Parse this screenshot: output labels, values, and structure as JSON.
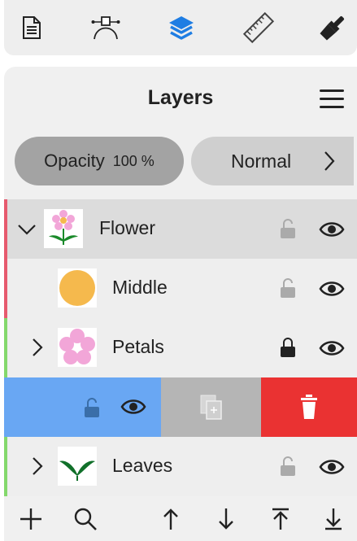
{
  "toolbar": {
    "tools": [
      {
        "icon": "document-icon",
        "active": false
      },
      {
        "icon": "vector-pen-icon",
        "active": false
      },
      {
        "icon": "layers-icon",
        "active": true
      },
      {
        "icon": "ruler-icon",
        "active": false
      },
      {
        "icon": "paint-brush-icon",
        "active": false
      }
    ],
    "active_color": "#1e7de3"
  },
  "panel": {
    "title": "Layers",
    "menu_icon": "hamburger-menu-icon"
  },
  "opacity": {
    "label": "Opacity",
    "value": "100 %"
  },
  "blend_mode": {
    "label": "Normal",
    "icon": "chevron-right-icon"
  },
  "layers": [
    {
      "name": "Flower",
      "expanded": true,
      "locked": false,
      "visible": true,
      "group_color": "#e65a6e",
      "thumb": "flower-thumbnail"
    },
    {
      "name": "Middle",
      "expanded": null,
      "locked": false,
      "visible": true,
      "group_color": "#e65a6e",
      "thumb": "orange-circle-thumbnail"
    },
    {
      "name": "Petals",
      "expanded": false,
      "locked": true,
      "visible": true,
      "group_color": "#84d86c",
      "thumb": "petals-thumbnail"
    },
    {
      "name": "Leaves",
      "expanded": false,
      "locked": false,
      "visible": true,
      "group_color": "#84d86c",
      "thumb": "leaves-thumbnail"
    }
  ],
  "swipe_actions": {
    "colors": {
      "blue": "#69a7f3",
      "gray": "#b5b5b5",
      "red": "#ea3232"
    },
    "icons": [
      "lock-open-icon",
      "eye-icon",
      "duplicate-icon",
      "trash-icon"
    ]
  },
  "bottom_bar": {
    "icons": [
      "add-icon",
      "search-icon",
      "move-up-icon",
      "move-down-icon",
      "move-to-top-icon",
      "move-to-bottom-icon"
    ]
  }
}
